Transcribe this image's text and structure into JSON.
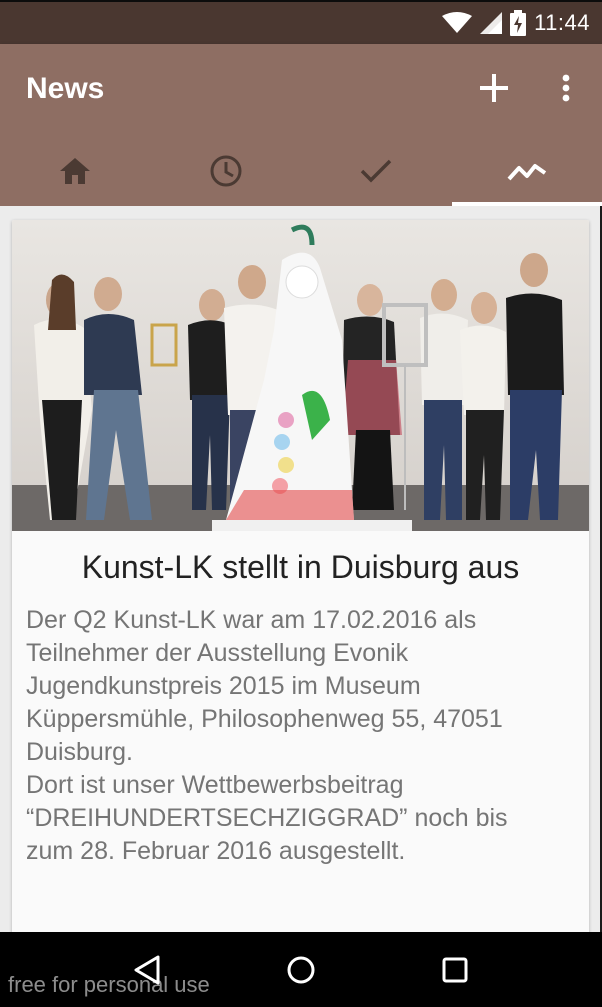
{
  "status_bar": {
    "time": "11:44",
    "icons": [
      "wifi-icon",
      "cell-signal-icon",
      "battery-charging-icon"
    ]
  },
  "app_bar": {
    "title": "News",
    "actions": [
      "add-icon",
      "more-vert-icon"
    ],
    "color": "#8e6e63"
  },
  "tabs": [
    {
      "icon": "home-icon",
      "active": false
    },
    {
      "icon": "clock-icon",
      "active": false
    },
    {
      "icon": "check-icon",
      "active": false
    },
    {
      "icon": "trending-icon",
      "active": true
    }
  ],
  "card": {
    "image": "group-photo-exhibition",
    "title": "Kunst-LK stellt in Duisburg aus",
    "body": "Der Q2 Kunst-LK war am 17.02.2016 als\nTeilnehmer der Ausstellung Evonik\nJugendkunstpreis 2015 im Museum\nKüppersmühle, Philosophenweg 55, 47051\nDuisburg.\nDort ist unser Wettbewerbsbeitrag\n“DREIHUNDERTSECHZIGGRAD” noch bis\nzum 28. Februar 2016 ausgestellt."
  },
  "nav_bar": {
    "buttons": [
      "back-icon",
      "home-circle-icon",
      "recents-icon"
    ]
  },
  "watermark": "free for personal use"
}
